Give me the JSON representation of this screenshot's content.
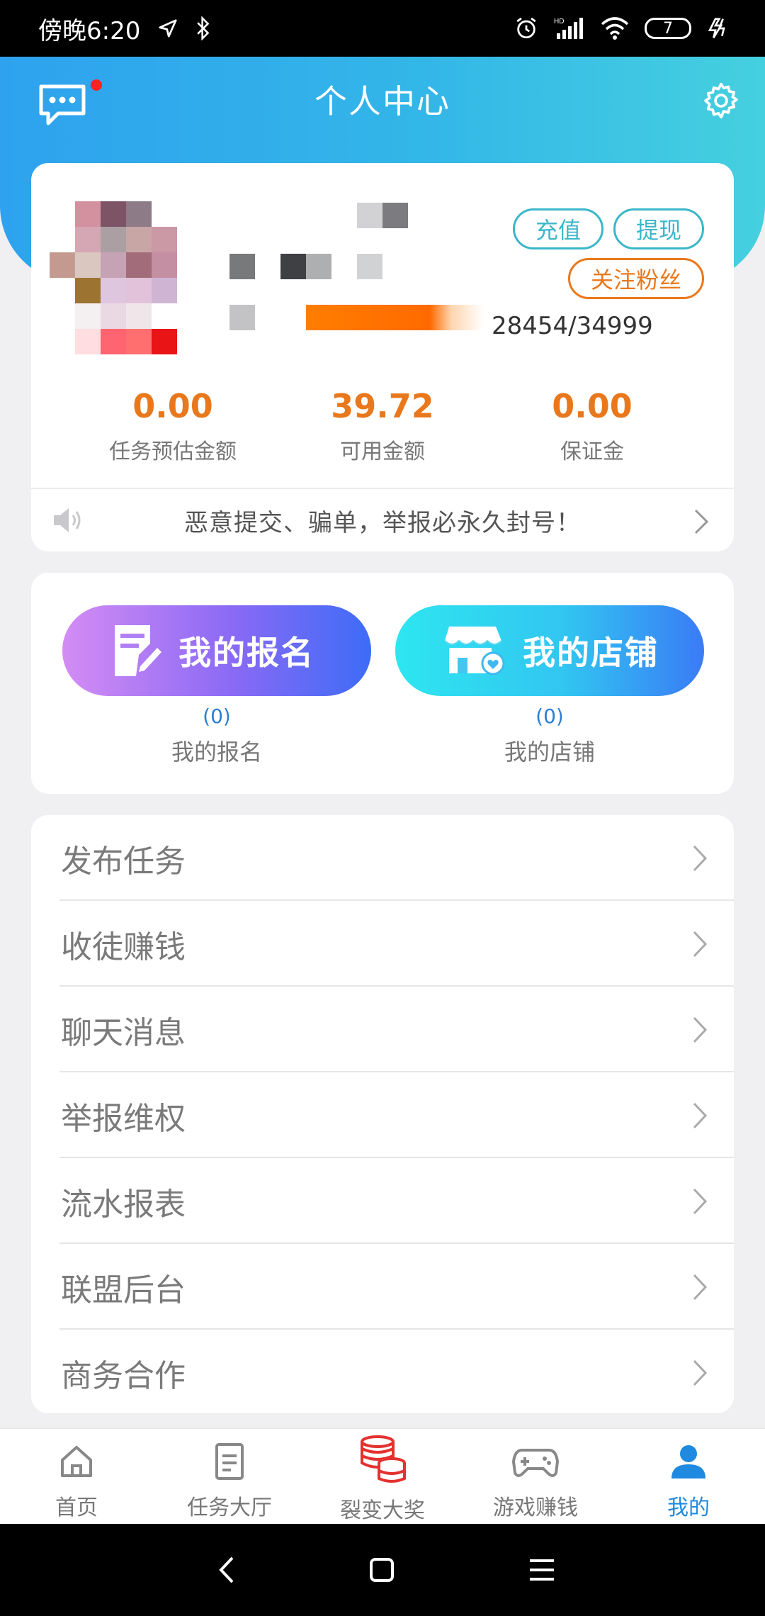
{
  "status_bar": {
    "time": "傍晚6:20",
    "battery": "7",
    "icons": [
      "location-arrow-icon",
      "bluetooth-icon",
      "alarm-icon",
      "hd-signal-icon",
      "wifi-icon",
      "battery-icon",
      "charging-icon"
    ]
  },
  "header": {
    "title": "个人中心",
    "left_icon": "chat-message-icon",
    "right_icon": "gear-icon",
    "has_notification_dot": true
  },
  "profile": {
    "buttons": {
      "recharge": "充值",
      "withdraw": "提现",
      "follow_fans": "关注粉丝"
    },
    "progress": {
      "text": "28454/34999",
      "current": 28454,
      "total": 34999
    },
    "stats": [
      {
        "value": "0.00",
        "label": "任务预估金额"
      },
      {
        "value": "39.72",
        "label": "可用金额"
      },
      {
        "value": "0.00",
        "label": "保证金"
      }
    ],
    "notice": "恶意提交、骗单，举报必永久封号！"
  },
  "actions": [
    {
      "button_label": "我的报名",
      "count": "(0)",
      "label": "我的报名",
      "icon": "edit-form-icon"
    },
    {
      "button_label": "我的店铺",
      "count": "(0)",
      "label": "我的店铺",
      "icon": "shop-icon"
    }
  ],
  "menu": [
    {
      "label": "发布任务"
    },
    {
      "label": "收徒赚钱"
    },
    {
      "label": "聊天消息"
    },
    {
      "label": "举报维权"
    },
    {
      "label": "流水报表"
    },
    {
      "label": "联盟后台"
    },
    {
      "label": "商务合作"
    }
  ],
  "bottom_nav": [
    {
      "label": "首页",
      "icon": "home-icon",
      "active": false
    },
    {
      "label": "任务大厅",
      "icon": "task-list-icon",
      "active": false
    },
    {
      "label": "裂变大奖",
      "icon": "coins-stack-icon",
      "active": false
    },
    {
      "label": "游戏赚钱",
      "icon": "gamepad-icon",
      "active": false
    },
    {
      "label": "我的",
      "icon": "user-icon",
      "active": true
    }
  ],
  "colors": {
    "accent_orange": "#e9781c",
    "accent_blue": "#1f8ae0",
    "teal_button": "#3ab7c9"
  }
}
